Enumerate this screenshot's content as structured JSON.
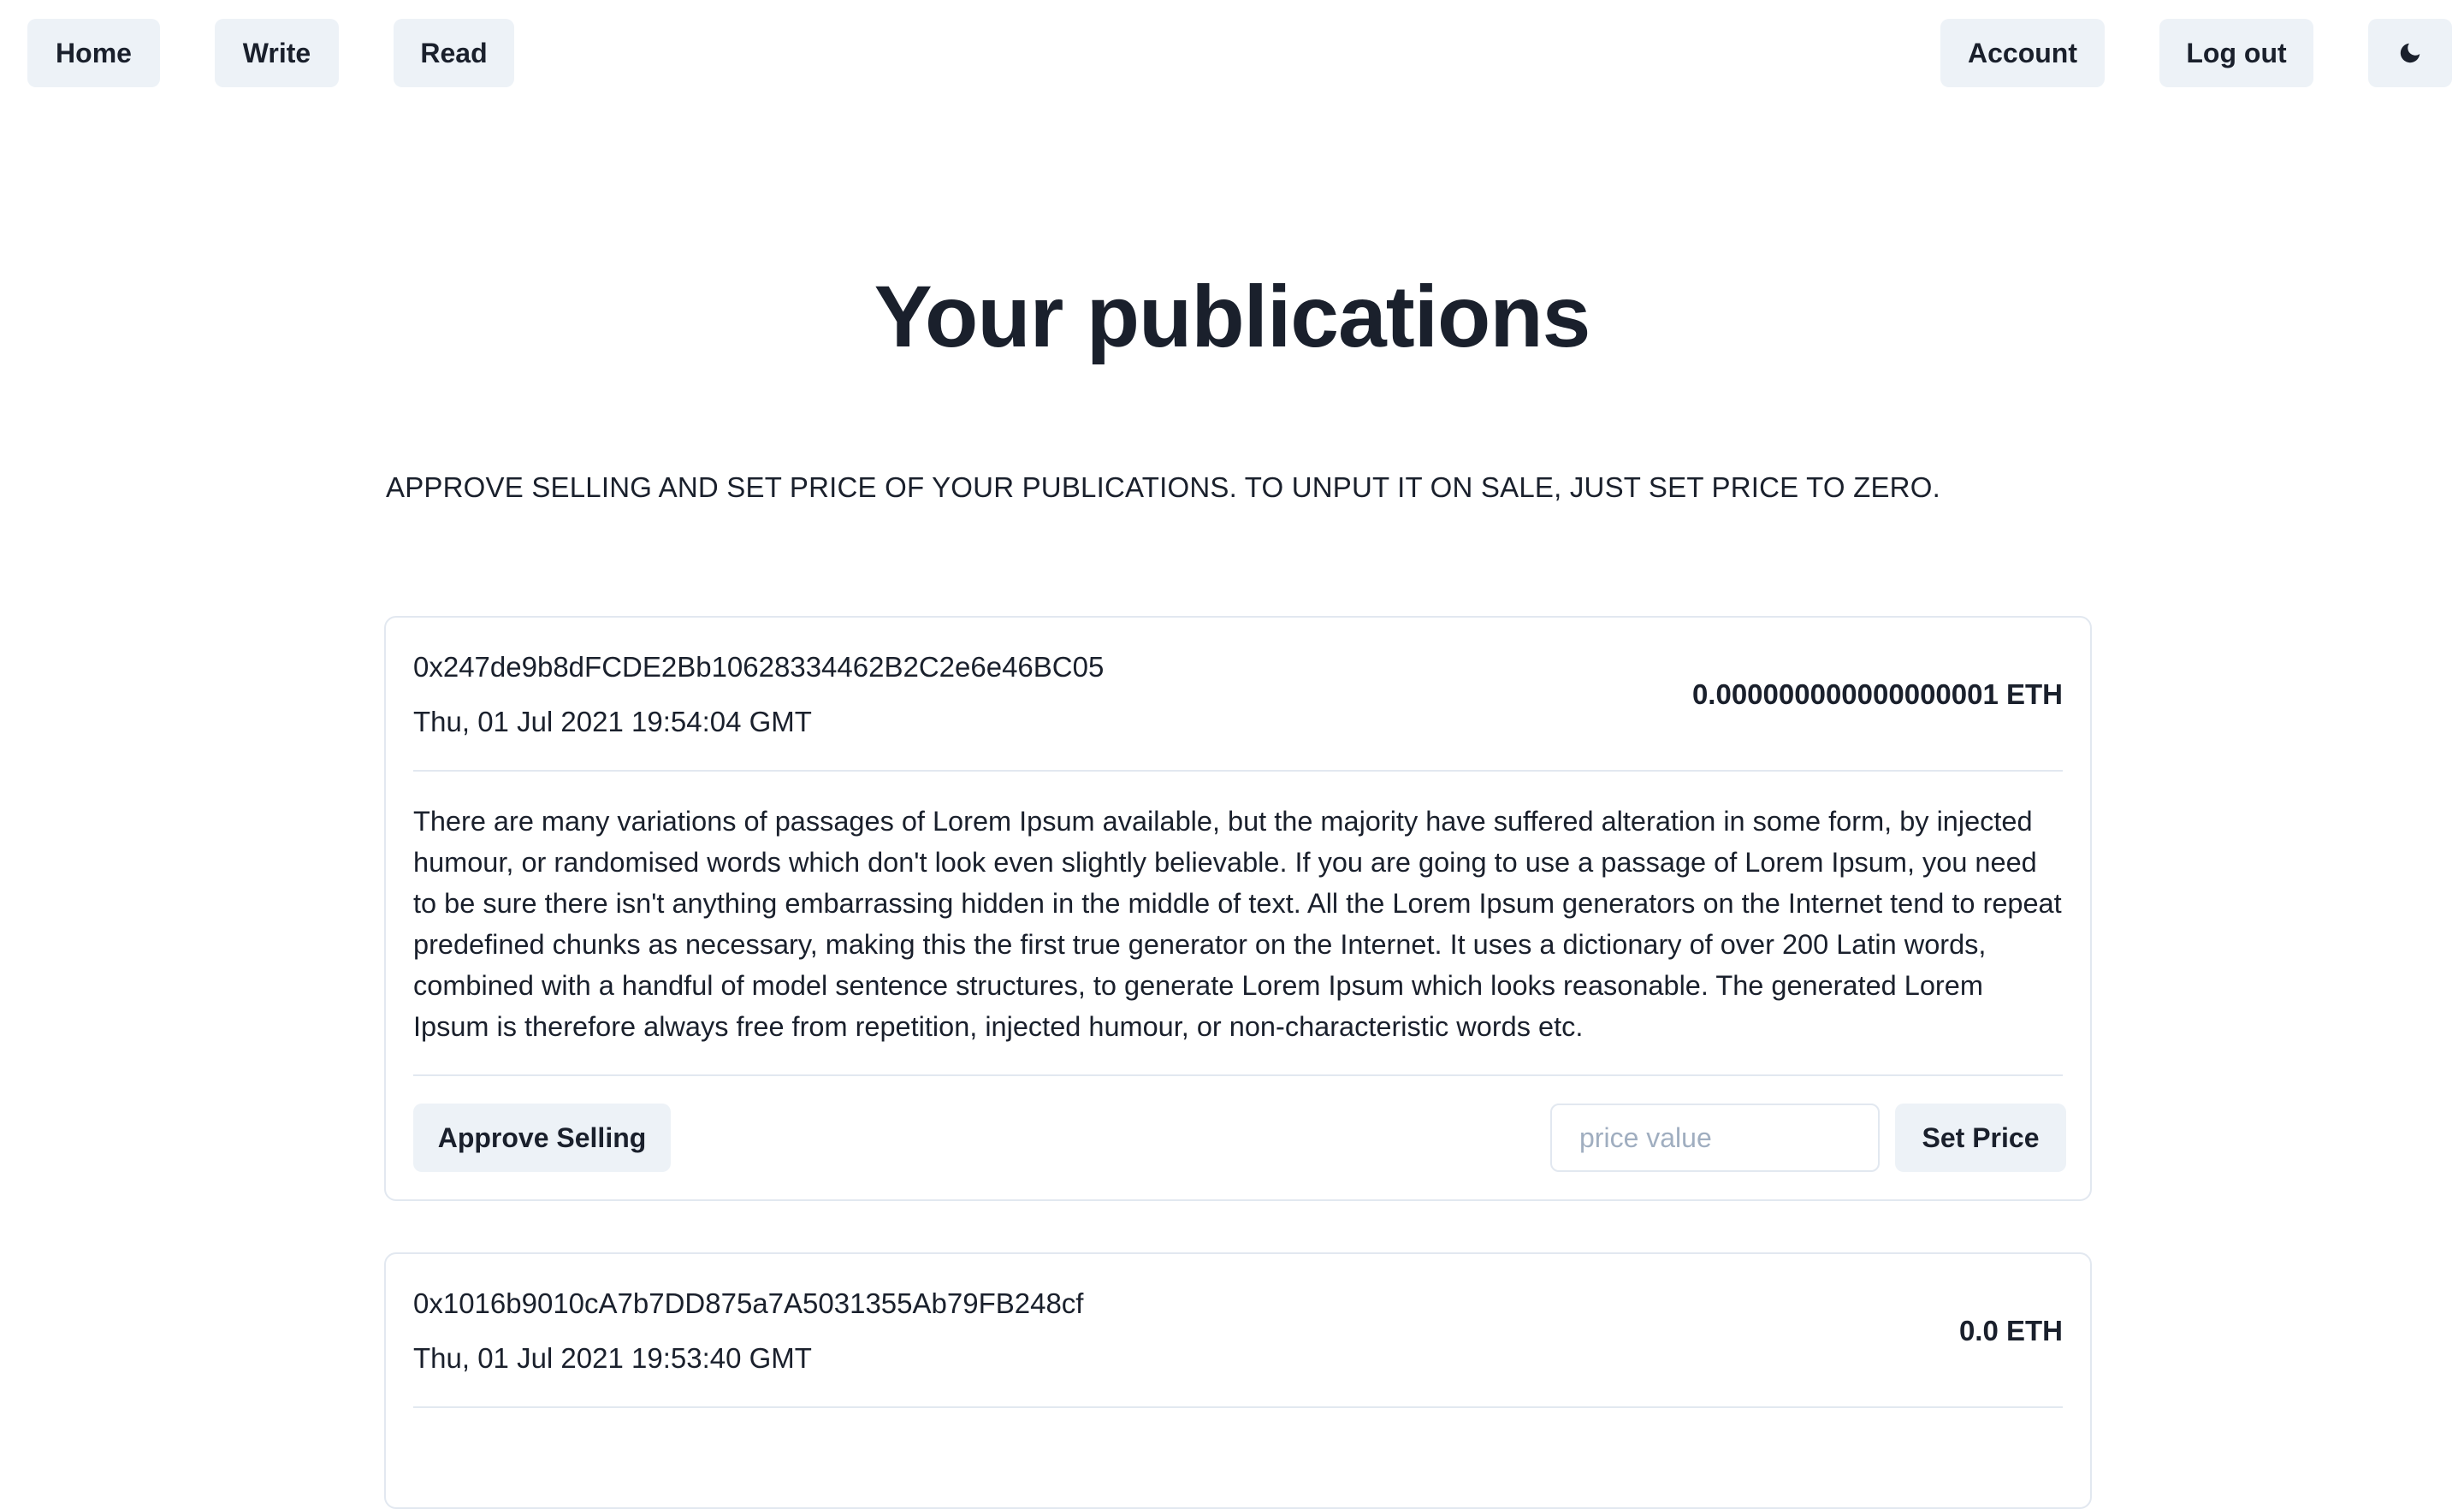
{
  "nav": {
    "home": "Home",
    "write": "Write",
    "read": "Read",
    "account": "Account",
    "logout": "Log out",
    "theme_icon": "moon-icon"
  },
  "page": {
    "title": "Your publications",
    "subtitle": "APPROVE SELLING AND SET PRICE OF YOUR PUBLICATIONS. TO UNPUT IT ON SALE, JUST SET PRICE TO ZERO."
  },
  "publications": [
    {
      "address": "0x247de9b8dFCDE2Bb10628334462B2C2e6e46BC05",
      "date": "Thu, 01 Jul 2021 19:54:04 GMT",
      "price": "0.000000000000000001 ETH",
      "text": "There are many variations of passages of Lorem Ipsum available, but the majority have suffered alteration in some form, by injected humour, or randomised words which don't look even slightly believable. If you are going to use a passage of Lorem Ipsum, you need to be sure there isn't anything embarrassing hidden in the middle of text. All the Lorem Ipsum generators on the Internet tend to repeat predefined chunks as necessary, making this the first true generator on the Internet. It uses a dictionary of over 200 Latin words, combined with a handful of model sentence structures, to generate Lorem Ipsum which looks reasonable. The generated Lorem Ipsum is therefore always free from repetition, injected humour, or non-characteristic words etc.",
      "approve_label": "Approve Selling",
      "price_placeholder": "price value",
      "set_price_label": "Set Price"
    },
    {
      "address": "0x1016b9010cA7b7DD875a7A5031355Ab79FB248cf",
      "date": "Thu, 01 Jul 2021 19:53:40 GMT",
      "price": "0.0 ETH"
    }
  ]
}
